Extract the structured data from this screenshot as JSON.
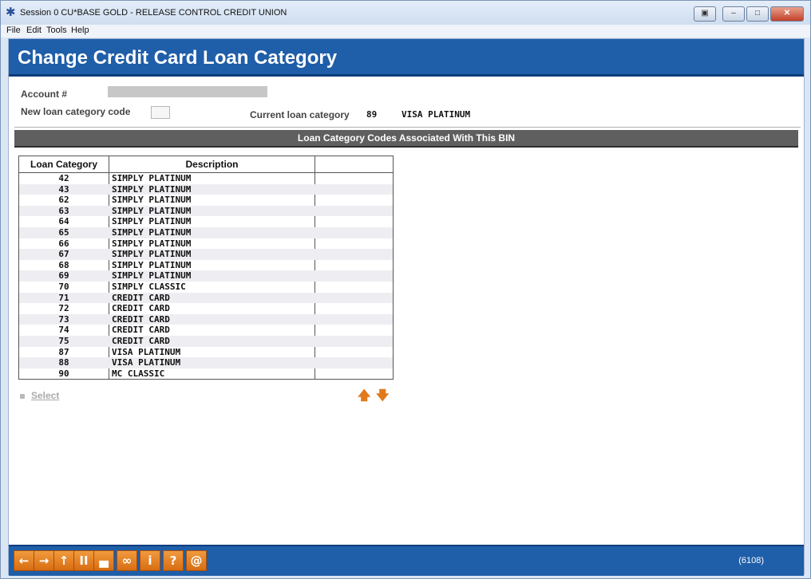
{
  "window": {
    "title": "Session 0 CU*BASE GOLD - RELEASE CONTROL CREDIT UNION",
    "icon": "cubase-star-icon",
    "buttons": [
      "restore-icon",
      "minimize-icon",
      "maximize-icon",
      "close-icon"
    ]
  },
  "menu": [
    "File",
    "Edit",
    "Tools",
    "Help"
  ],
  "page": {
    "title": "Change Credit Card Loan Category"
  },
  "form": {
    "account_label": "Account #",
    "account_value": "",
    "new_code_label": "New loan category code",
    "new_code_value": "",
    "current_label": "Current loan category",
    "current_code": "89",
    "current_desc": "VISA PLATINUM"
  },
  "section": {
    "title": "Loan Category Codes Associated With This BIN"
  },
  "table": {
    "headers": [
      "Loan Category",
      "Description",
      ""
    ],
    "rows": [
      {
        "code": "42",
        "desc": "SIMPLY PLATINUM"
      },
      {
        "code": "43",
        "desc": "SIMPLY PLATINUM"
      },
      {
        "code": "62",
        "desc": "SIMPLY PLATINUM"
      },
      {
        "code": "63",
        "desc": "SIMPLY PLATINUM"
      },
      {
        "code": "64",
        "desc": "SIMPLY PLATINUM"
      },
      {
        "code": "65",
        "desc": "SIMPLY PLATINUM"
      },
      {
        "code": "66",
        "desc": "SIMPLY PLATINUM"
      },
      {
        "code": "67",
        "desc": "SIMPLY PLATINUM"
      },
      {
        "code": "68",
        "desc": "SIMPLY PLATINUM"
      },
      {
        "code": "69",
        "desc": "SIMPLY PLATINUM"
      },
      {
        "code": "70",
        "desc": "SIMPLY CLASSIC"
      },
      {
        "code": "71",
        "desc": "CREDIT CARD"
      },
      {
        "code": "72",
        "desc": "CREDIT CARD"
      },
      {
        "code": "73",
        "desc": "CREDIT CARD"
      },
      {
        "code": "74",
        "desc": "CREDIT CARD"
      },
      {
        "code": "75",
        "desc": "CREDIT CARD"
      },
      {
        "code": "87",
        "desc": "VISA PLATINUM"
      },
      {
        "code": "88",
        "desc": "VISA PLATINUM"
      },
      {
        "code": "90",
        "desc": "MC CLASSIC"
      }
    ]
  },
  "options": {
    "select": "Select"
  },
  "toolbar": {
    "buttons": [
      {
        "name": "back-arrow-icon",
        "glyph": "←"
      },
      {
        "name": "forward-arrow-icon",
        "glyph": "→"
      },
      {
        "name": "up-arrow-icon",
        "glyph": "↑"
      },
      {
        "name": "pause-icon",
        "glyph": "II"
      },
      {
        "name": "print-icon",
        "glyph": "▄"
      },
      {
        "name": "link-icon",
        "glyph": "∞"
      },
      {
        "name": "info-icon",
        "glyph": "i"
      },
      {
        "name": "help-icon",
        "glyph": "?"
      },
      {
        "name": "at-icon",
        "glyph": "@"
      }
    ]
  },
  "status": {
    "screen_id": "(6108)"
  },
  "colors": {
    "header_blue": "#1f5ea8",
    "section_gray": "#5f5f5f",
    "arrow_orange": "#e07a1c",
    "toolbar_orange": "#ea8a2a"
  }
}
